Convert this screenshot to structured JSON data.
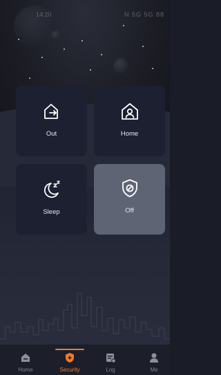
{
  "status_bar": {
    "time": "14:20",
    "indicators": "N 5G 5G 88"
  },
  "modes": [
    {
      "label": "Out",
      "icon": "leave-home-icon",
      "active": false
    },
    {
      "label": "Home",
      "icon": "home-user-icon",
      "active": false
    },
    {
      "label": "Sleep",
      "icon": "sleep-moon-icon",
      "active": false
    },
    {
      "label": "Off",
      "icon": "shield-off-icon",
      "active": true
    }
  ],
  "tabs": [
    {
      "label": "Home",
      "icon": "home-icon",
      "active": false
    },
    {
      "label": "Security",
      "icon": "security-shield-icon",
      "active": true
    },
    {
      "label": "Log",
      "icon": "log-icon",
      "active": false
    },
    {
      "label": "Me",
      "icon": "user-icon",
      "active": false
    }
  ],
  "colors": {
    "accent": "#f07a2c",
    "card": "#1c2030",
    "card_active": "#5f6474",
    "background": "#1f2230"
  }
}
